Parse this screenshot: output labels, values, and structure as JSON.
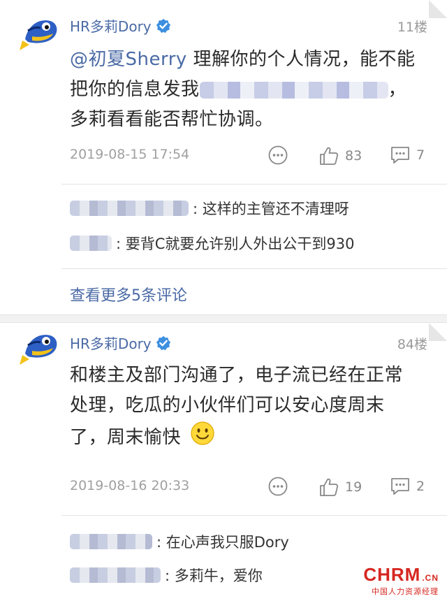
{
  "posts": [
    {
      "author": "HR多莉Dory",
      "floor": "11楼",
      "mention": "@初夏Sherry",
      "text_line1": " 理解你的个人情况，能不能",
      "text_line2_a": "把你的信息发我",
      "text_line2_b": "，",
      "text_line3": "多莉看看能否帮忙协调。",
      "date": "2019-08-15 17:54",
      "likes": "83",
      "comments": "7",
      "replies": [
        {
          "user": "…恢复也安稳",
          "text": ": 这样的主管还不清理呀"
        },
        {
          "user": "…平",
          "text": ": 要背C就要允许别人外出公干到930"
        }
      ],
      "more_replies": "查看更多5条评论"
    },
    {
      "author": "HR多莉Dory",
      "floor": "84楼",
      "text_line1": "和楼主及部门沟通了，电子流已经在正常",
      "text_line2": "处理，吃瓜的小伙伴们可以安心度周末",
      "text_line3": "了，周末愉快",
      "date": "2019-08-16 20:33",
      "likes": "19",
      "comments": "2",
      "replies": [
        {
          "user": "…",
          "text": ": 在心声我只服Dory"
        },
        {
          "user": "光着…街",
          "text": ": 多莉牛，爱你"
        }
      ]
    }
  ],
  "icons": {
    "avatar": "dory-fish-avatar",
    "verified": "verified-badge-icon",
    "more": "more-options-icon",
    "like": "thumbs-up-icon",
    "comment": "comment-icon",
    "emoji": "smiley-emoji"
  },
  "colors": {
    "link": "#4a6aa5",
    "verified": "#3d8fe0",
    "watermark": "#d6261f"
  },
  "watermark": {
    "brand": "CHRM",
    "suffix": ".CN",
    "sub": "中国人力资源经理"
  }
}
